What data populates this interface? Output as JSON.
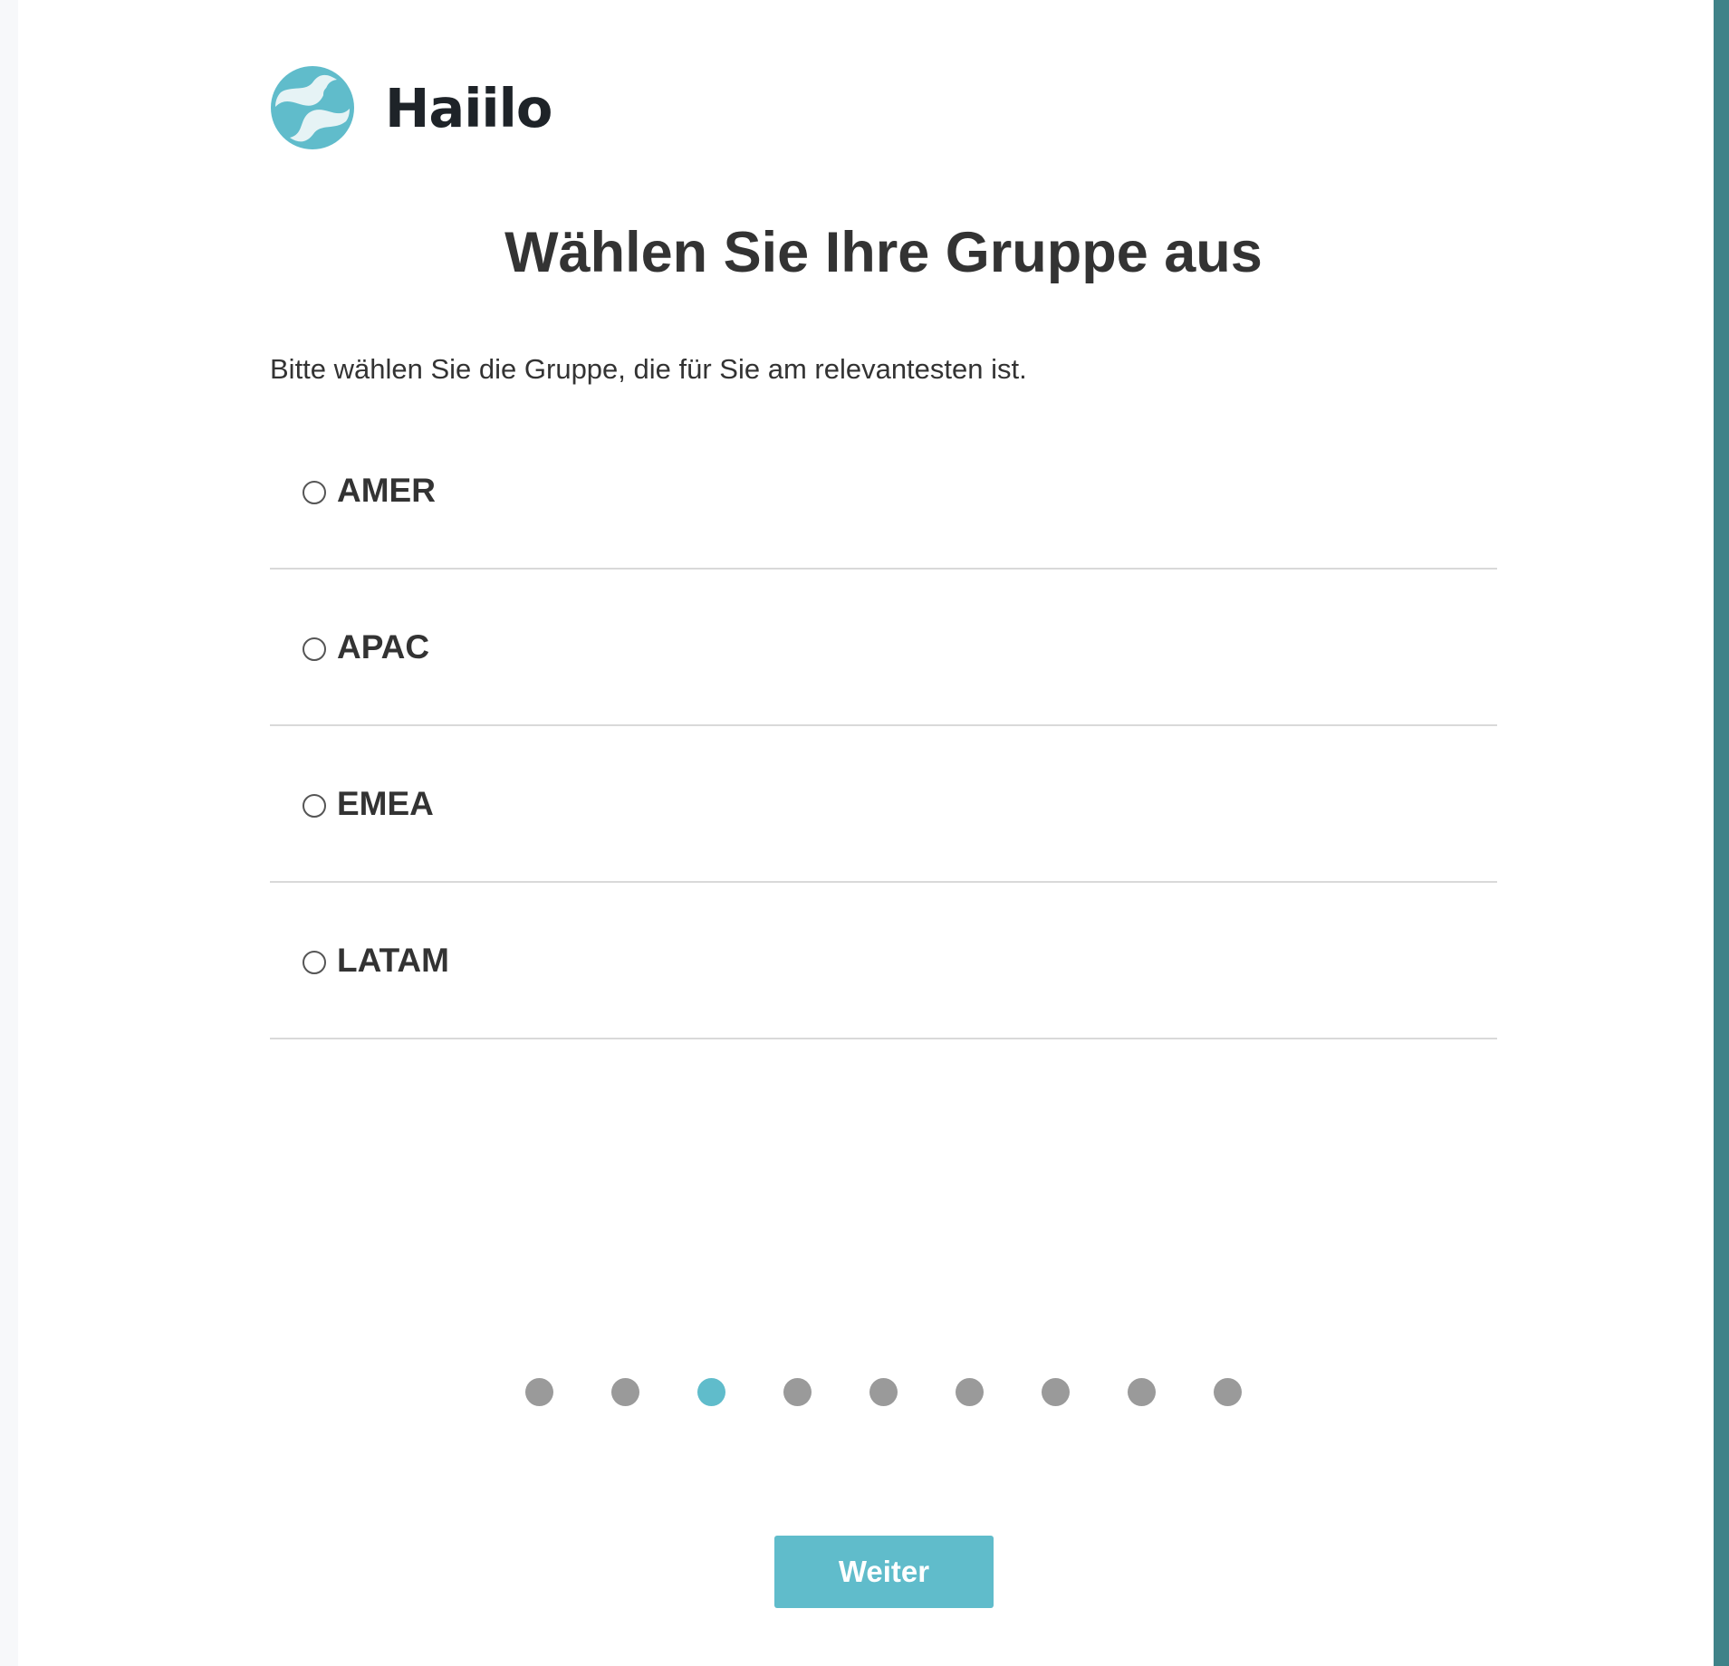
{
  "brand": {
    "name": "Haiilo",
    "accent": "#60bccb",
    "side_bar_color": "#3f8288"
  },
  "page": {
    "title": "Wählen Sie Ihre Gruppe aus",
    "subtitle": "Bitte wählen Sie die Gruppe, die für Sie am relevantesten ist."
  },
  "options": [
    {
      "label": "AMER",
      "selected": false
    },
    {
      "label": "APAC",
      "selected": false
    },
    {
      "label": "EMEA",
      "selected": false
    },
    {
      "label": "LATAM",
      "selected": false
    }
  ],
  "progress": {
    "total_steps": 9,
    "current_step": 3
  },
  "footer": {
    "next_label": "Weiter"
  }
}
